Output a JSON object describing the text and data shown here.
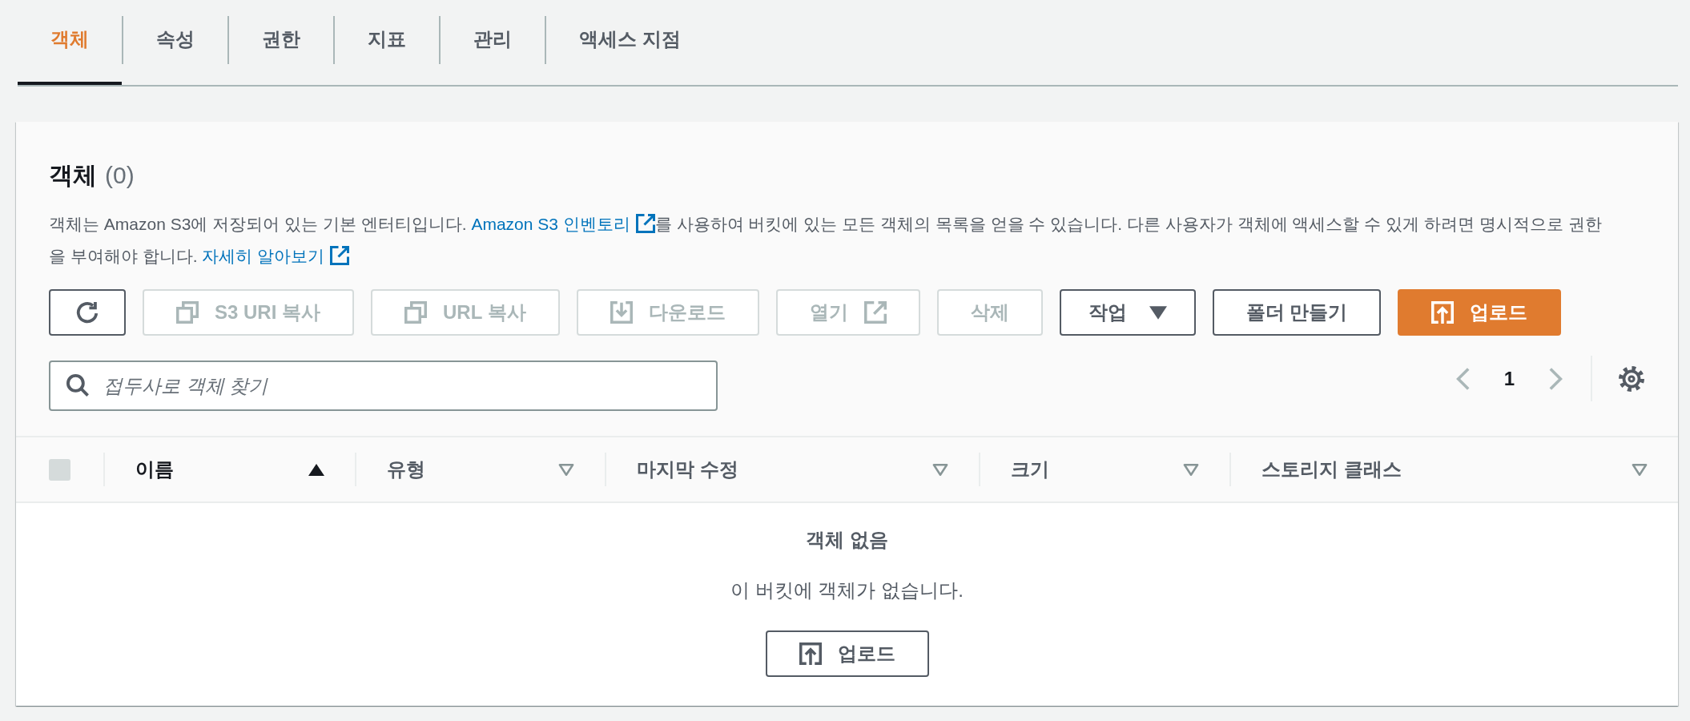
{
  "tabs": [
    {
      "label": "객체",
      "selected": true
    },
    {
      "label": "속성",
      "selected": false
    },
    {
      "label": "권한",
      "selected": false
    },
    {
      "label": "지표",
      "selected": false
    },
    {
      "label": "관리",
      "selected": false
    },
    {
      "label": "액세스 지점",
      "selected": false
    }
  ],
  "panel": {
    "title": "객체",
    "count": "(0)",
    "description": [
      {
        "kind": "text",
        "text": "객체는 Amazon S3에 저장되어 있는 기본 엔터티입니다. "
      },
      {
        "kind": "link",
        "text": "Amazon S3 인벤토리"
      },
      {
        "kind": "text",
        "text": "를 사용하여 버킷에 있는 모든 객체의 목록을 얻을 수 있습니다. 다른 사용자가 객체에 액세스할 수 있게 하려면 명시적으로 권한을 부여해야 합니다. "
      },
      {
        "kind": "link",
        "text": "자세히 알아보기"
      }
    ],
    "actions": [
      {
        "kind": "refresh",
        "disabled": false,
        "primary": false
      },
      {
        "kind": "copy",
        "label": "S3 URI 복사",
        "disabled": true,
        "primary": false
      },
      {
        "kind": "copy",
        "label": "URL 복사",
        "disabled": true,
        "primary": false
      },
      {
        "kind": "download",
        "label": "다운로드",
        "disabled": true,
        "primary": false
      },
      {
        "kind": "open",
        "label": "열기",
        "disabled": true,
        "primary": false
      },
      {
        "kind": "delete",
        "label": "삭제",
        "disabled": true,
        "primary": false
      },
      {
        "kind": "actions",
        "label": "작업",
        "disabled": false,
        "primary": false
      },
      {
        "kind": "create",
        "label": "폴더 만들기",
        "disabled": false,
        "primary": false
      },
      {
        "kind": "upload",
        "label": "업로드",
        "disabled": false,
        "primary": true
      }
    ],
    "search": {
      "placeholder": "접두사로 객체 찾기"
    },
    "pagination": {
      "previous_disabled": true,
      "pages": [
        {
          "label": "1",
          "selected": true
        }
      ],
      "next_disabled": true
    },
    "table": {
      "select_all": {
        "checked": false,
        "disabled": true
      },
      "columns": [
        {
          "label": "이름",
          "sorted": true,
          "descending": false
        },
        {
          "label": "유형",
          "sorted": false
        },
        {
          "label": "마지막 수정",
          "sorted": false
        },
        {
          "label": "크기",
          "sorted": false
        },
        {
          "label": "스토리지 클래스",
          "sorted": false
        }
      ],
      "empty_state": {
        "title": "객체 없음",
        "message": "이 버킷에 객체가 없습니다.",
        "button": {
          "kind": "upload",
          "label": "업로드",
          "disabled": false,
          "primary": false
        }
      }
    }
  }
}
